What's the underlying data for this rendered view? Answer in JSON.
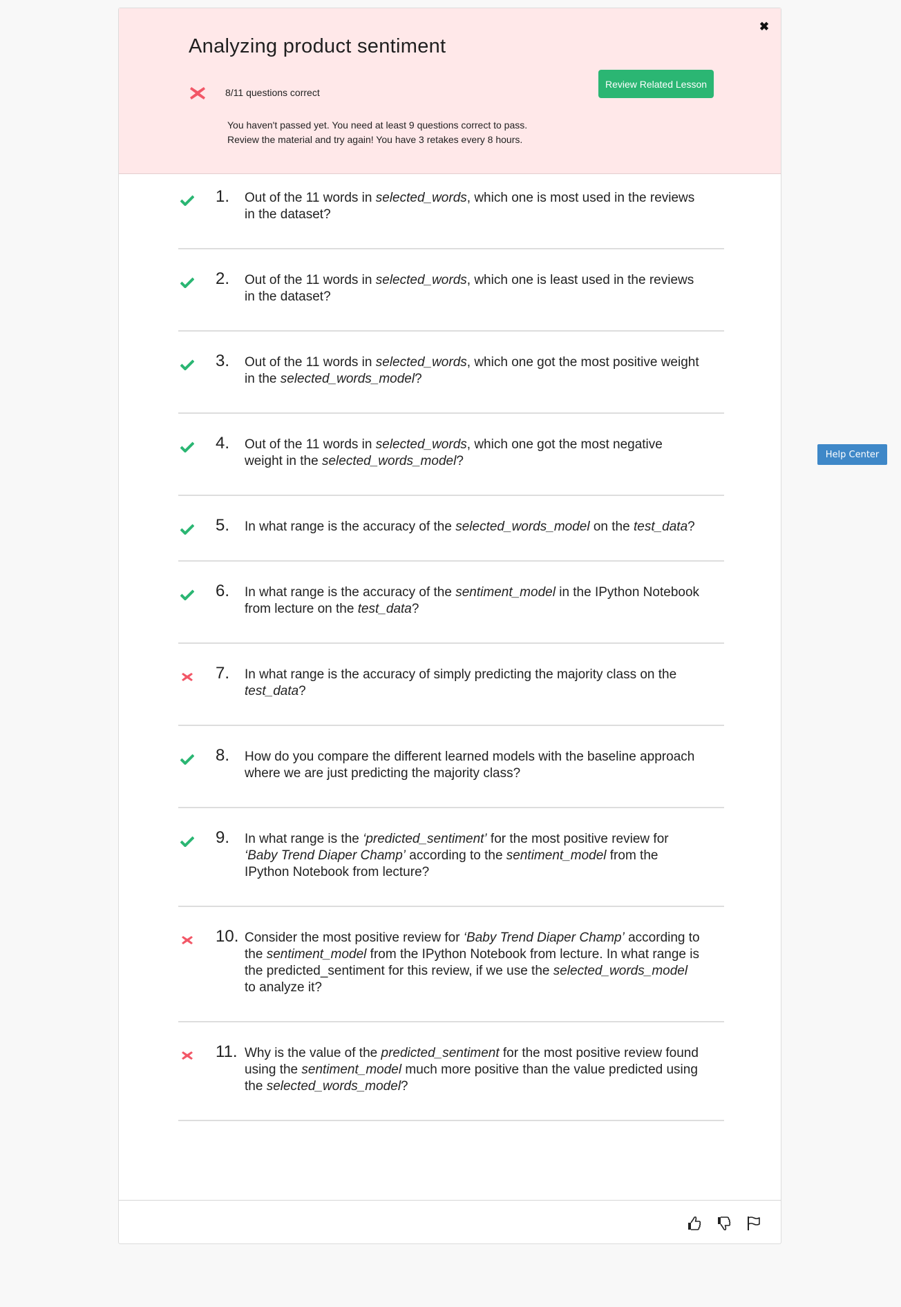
{
  "header": {
    "title": "Analyzing product sentiment",
    "close_icon": "close-icon",
    "score_icon": "fail-x-icon",
    "score_text": "8/11 questions correct",
    "review_button_label": "Review Related Lesson",
    "message_line1": "You haven't passed yet. You need at least 9 questions correct to pass.",
    "message_line2": "Review the material and try again! You have 3 retakes every 8 hours.",
    "colors": {
      "header_bg": "#ffe8e9",
      "button_bg": "#2bb673",
      "fail": "#f25767",
      "pass": "#2bb673"
    }
  },
  "questions": [
    {
      "number": "1.",
      "status": "correct",
      "segments": [
        {
          "t": "Out of the 11 words in "
        },
        {
          "t": "selected_words",
          "i": true
        },
        {
          "t": ", which one is most used in the reviews in the dataset?"
        }
      ]
    },
    {
      "number": "2.",
      "status": "correct",
      "segments": [
        {
          "t": "Out of the 11 words in "
        },
        {
          "t": "selected_words",
          "i": true
        },
        {
          "t": ", which one is least used in the reviews in the dataset?"
        }
      ]
    },
    {
      "number": "3.",
      "status": "correct",
      "segments": [
        {
          "t": "Out of the 11 words in "
        },
        {
          "t": "selected_words",
          "i": true
        },
        {
          "t": ", which one got the most positive weight in the "
        },
        {
          "t": "selected_words_model",
          "i": true
        },
        {
          "t": "?"
        }
      ]
    },
    {
      "number": "4.",
      "status": "correct",
      "segments": [
        {
          "t": "Out of the 11 words in "
        },
        {
          "t": "selected_words",
          "i": true
        },
        {
          "t": ", which one got the most negative weight in the "
        },
        {
          "t": "selected_words_model",
          "i": true
        },
        {
          "t": "?"
        }
      ]
    },
    {
      "number": "5.",
      "status": "correct",
      "segments": [
        {
          "t": "In what range is the accuracy of the "
        },
        {
          "t": "selected_words_model",
          "i": true
        },
        {
          "t": " on the "
        },
        {
          "t": "test_data",
          "i": true
        },
        {
          "t": "?"
        }
      ]
    },
    {
      "number": "6.",
      "status": "correct",
      "segments": [
        {
          "t": "In what range is the accuracy of the "
        },
        {
          "t": "sentiment_model",
          "i": true
        },
        {
          "t": " in the IPython Notebook from lecture on the "
        },
        {
          "t": "test_data",
          "i": true
        },
        {
          "t": "?"
        }
      ]
    },
    {
      "number": "7.",
      "status": "incorrect",
      "segments": [
        {
          "t": "In what range is the accuracy of simply predicting the majority class on the "
        },
        {
          "t": "test_data",
          "i": true
        },
        {
          "t": "?"
        }
      ]
    },
    {
      "number": "8.",
      "status": "correct",
      "segments": [
        {
          "t": "How do you compare the different learned models with the baseline approach where we are just predicting the majority class?"
        }
      ]
    },
    {
      "number": "9.",
      "status": "correct",
      "segments": [
        {
          "t": "In what range is the "
        },
        {
          "t": "‘predicted_sentiment’",
          "i": true
        },
        {
          "t": " for the most positive review for "
        },
        {
          "t": "‘Baby Trend Diaper Champ’",
          "i": true
        },
        {
          "t": " according to the "
        },
        {
          "t": "sentiment_model",
          "i": true
        },
        {
          "t": " from the IPython Notebook from lecture?"
        }
      ]
    },
    {
      "number": "10.",
      "status": "incorrect",
      "segments": [
        {
          "t": "Consider the most positive review for "
        },
        {
          "t": "‘Baby Trend Diaper Champ’",
          "i": true
        },
        {
          "t": " according to the "
        },
        {
          "t": "sentiment_model",
          "i": true
        },
        {
          "t": " from the IPython Notebook from lecture. In what range is the predicted_sentiment for this review, if we use the "
        },
        {
          "t": "selected_words_model",
          "i": true
        },
        {
          "t": " to analyze it?"
        }
      ]
    },
    {
      "number": "11.",
      "status": "incorrect",
      "segments": [
        {
          "t": "Why is the value of the "
        },
        {
          "t": "predicted_sentiment",
          "i": true
        },
        {
          "t": " for the most positive review found using the "
        },
        {
          "t": "sentiment_model",
          "i": true
        },
        {
          "t": " much more positive than the value predicted using the "
        },
        {
          "t": "selected_words_model",
          "i": true
        },
        {
          "t": "?"
        }
      ]
    }
  ],
  "footer": {
    "icons": [
      "thumbs-up-icon",
      "thumbs-down-icon",
      "flag-icon"
    ]
  },
  "help_center_label": "Help Center"
}
